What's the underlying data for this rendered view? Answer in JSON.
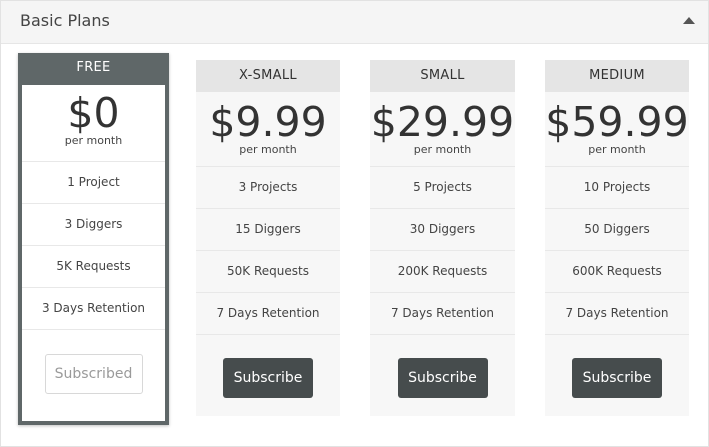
{
  "panel": {
    "title": "Basic Plans",
    "collapse_icon": "caret-up-icon"
  },
  "plans": [
    {
      "name": "FREE",
      "price": "$0",
      "period": "per month",
      "features": [
        "1 Project",
        "3 Diggers",
        "5K Requests",
        "3 Days Retention"
      ],
      "action_label": "Subscribed",
      "current": true
    },
    {
      "name": "X-SMALL",
      "price": "$9.99",
      "period": "per month",
      "features": [
        "3 Projects",
        "15 Diggers",
        "50K Requests",
        "7 Days Retention"
      ],
      "action_label": "Subscribe",
      "current": false
    },
    {
      "name": "SMALL",
      "price": "$29.99",
      "period": "per month",
      "features": [
        "5 Projects",
        "30 Diggers",
        "200K Requests",
        "7 Days Retention"
      ],
      "action_label": "Subscribe",
      "current": false
    },
    {
      "name": "MEDIUM",
      "price": "$59.99",
      "period": "per month",
      "features": [
        "10 Projects",
        "50 Diggers",
        "600K Requests",
        "7 Days Retention"
      ],
      "action_label": "Subscribe",
      "current": false
    }
  ],
  "colors": {
    "accent_dark": "#5f6768",
    "button_bg": "#464c4d",
    "header_bg": "#f5f5f5"
  }
}
